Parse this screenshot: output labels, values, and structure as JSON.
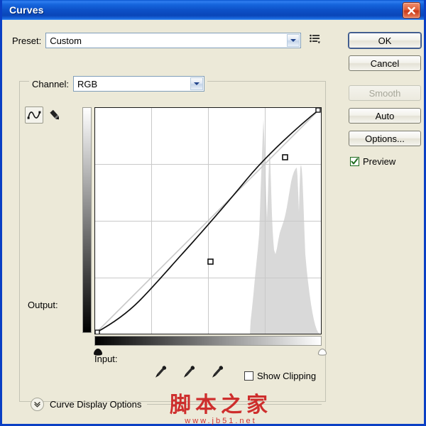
{
  "window": {
    "title": "Curves",
    "close_label": "Close",
    "close_icon": "close-icon"
  },
  "preset": {
    "label": "Preset:",
    "value": "Custom",
    "placeholder": "Custom",
    "menu_icon": "preset-menu-icon",
    "dropdown_icon": "chevron-down-icon"
  },
  "channel": {
    "label": "Channel:",
    "value": "RGB",
    "dropdown_icon": "chevron-down-icon"
  },
  "tools": {
    "curve_icon": "curve-tool-icon",
    "pencil_icon": "pencil-tool-icon",
    "curve_label": "Edit points to modify the curve",
    "pencil_label": "Draw to modify the curve"
  },
  "graph": {
    "output_label": "Output:",
    "input_label": "Input:"
  },
  "eyedroppers": [
    {
      "name": "black-point-eyedropper",
      "label": "Sample in image to set black point"
    },
    {
      "name": "gray-point-eyedropper",
      "label": "Sample in image to set gray point"
    },
    {
      "name": "white-point-eyedropper",
      "label": "Sample in image to set white point"
    }
  ],
  "show_clipping": {
    "label": "Show Clipping",
    "checked": false
  },
  "curve_display_options": {
    "label": "Curve Display Options",
    "expanded": false,
    "toggle_icon": "chevron-down-icon"
  },
  "buttons": {
    "ok": "OK",
    "cancel": "Cancel",
    "smooth": "Smooth",
    "auto": "Auto",
    "options": "Options..."
  },
  "preview": {
    "label": "Preview",
    "checked": true,
    "check_icon": "checkmark-icon"
  },
  "watermark": {
    "main": "脚本之家",
    "sub": "www.jb51.net"
  },
  "colors": {
    "titlebar_blue": "#0d51c8",
    "dialog_face": "#ece9d8",
    "close_red": "#c8391a",
    "check_green": "#1d6b1d",
    "combo_border": "#7f9db9",
    "watermark_red": "#cc1f1f",
    "histogram_gray": "#d9d9d9",
    "curve_black": "#101010",
    "baseline_gray": "#c8c8c8",
    "grid_gray": "#c9c9c9"
  },
  "chart_data": {
    "type": "line",
    "title": "Curves tone curve (RGB)",
    "xlabel": "Input",
    "ylabel": "Output",
    "xlim": [
      0,
      255
    ],
    "ylim": [
      0,
      255
    ],
    "grid": true,
    "grid_divisions": 4,
    "legend": "none",
    "series": [
      {
        "name": "baseline",
        "style": "straight-gray-diagonal",
        "points": [
          [
            0,
            0
          ],
          [
            255,
            255
          ]
        ]
      },
      {
        "name": "tone-curve",
        "style": "black-spline",
        "control_points": [
          [
            0,
            0
          ],
          [
            108,
            79
          ],
          [
            198,
            198
          ],
          [
            255,
            255
          ]
        ],
        "points": [
          [
            0,
            0
          ],
          [
            16,
            8
          ],
          [
            32,
            18
          ],
          [
            48,
            30
          ],
          [
            64,
            42
          ],
          [
            80,
            54
          ],
          [
            96,
            68
          ],
          [
            108,
            79
          ],
          [
            128,
            100
          ],
          [
            144,
            119
          ],
          [
            160,
            140
          ],
          [
            176,
            161
          ],
          [
            198,
            198
          ],
          [
            216,
            217
          ],
          [
            232,
            232
          ],
          [
            255,
            255
          ]
        ]
      }
    ],
    "histogram": {
      "name": "image-histogram",
      "fill": "#d9d9d9",
      "bins": 64,
      "values": [
        0,
        0,
        0,
        0,
        0,
        0,
        0,
        0,
        0,
        0,
        0,
        0,
        0,
        0,
        0,
        0,
        0,
        0,
        0,
        0,
        0,
        0,
        0,
        0,
        0,
        0,
        0,
        1,
        2,
        3,
        4,
        6,
        9,
        14,
        22,
        34,
        52,
        72,
        88,
        96,
        62,
        48,
        58,
        74,
        92,
        100,
        78,
        52,
        34,
        22,
        58,
        18,
        12,
        8,
        5,
        3,
        2,
        1,
        1,
        0,
        0,
        0,
        0,
        0
      ]
    }
  }
}
